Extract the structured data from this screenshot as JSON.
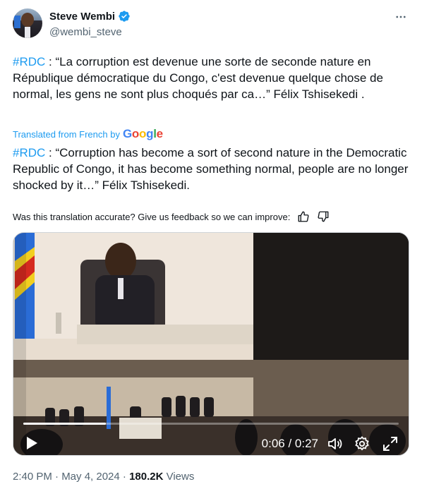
{
  "author": {
    "display_name": "Steve Wembi",
    "handle": "@wembi_steve",
    "verified": true
  },
  "tweet": {
    "original_hashtag": "#RDC",
    "original_text": " : “La corruption est devenue une sorte de seconde nature en République démocratique du Congo, c'est devenue quelque chose de normal, les gens ne sont plus choqués par ca…” Félix Tshisekedi .",
    "translated_from": "Translated from French by",
    "translator_brand": "Google",
    "translated_hashtag": "#RDC",
    "translated_text": " : “Corruption has become a sort of second nature in the Democratic Republic of Congo, it has become something normal, people are no longer shocked by it…” Félix Tshisekedi."
  },
  "feedback": {
    "prompt": "Was this translation accurate? Give us feedback so we can improve:",
    "thumbs_up_icon": "thumbs-up-icon",
    "thumbs_down_icon": "thumbs-down-icon"
  },
  "video": {
    "current_time": "0:06",
    "separator": " / ",
    "duration": "0:27",
    "progress": 0.22
  },
  "meta": {
    "time": "2:40 PM · May 4, 2024 · ",
    "views_count": "180.2K",
    "views_label": " Views"
  },
  "colors": {
    "accent": "#1d9bf0",
    "text": "#0f1419",
    "secondary": "#536471"
  }
}
